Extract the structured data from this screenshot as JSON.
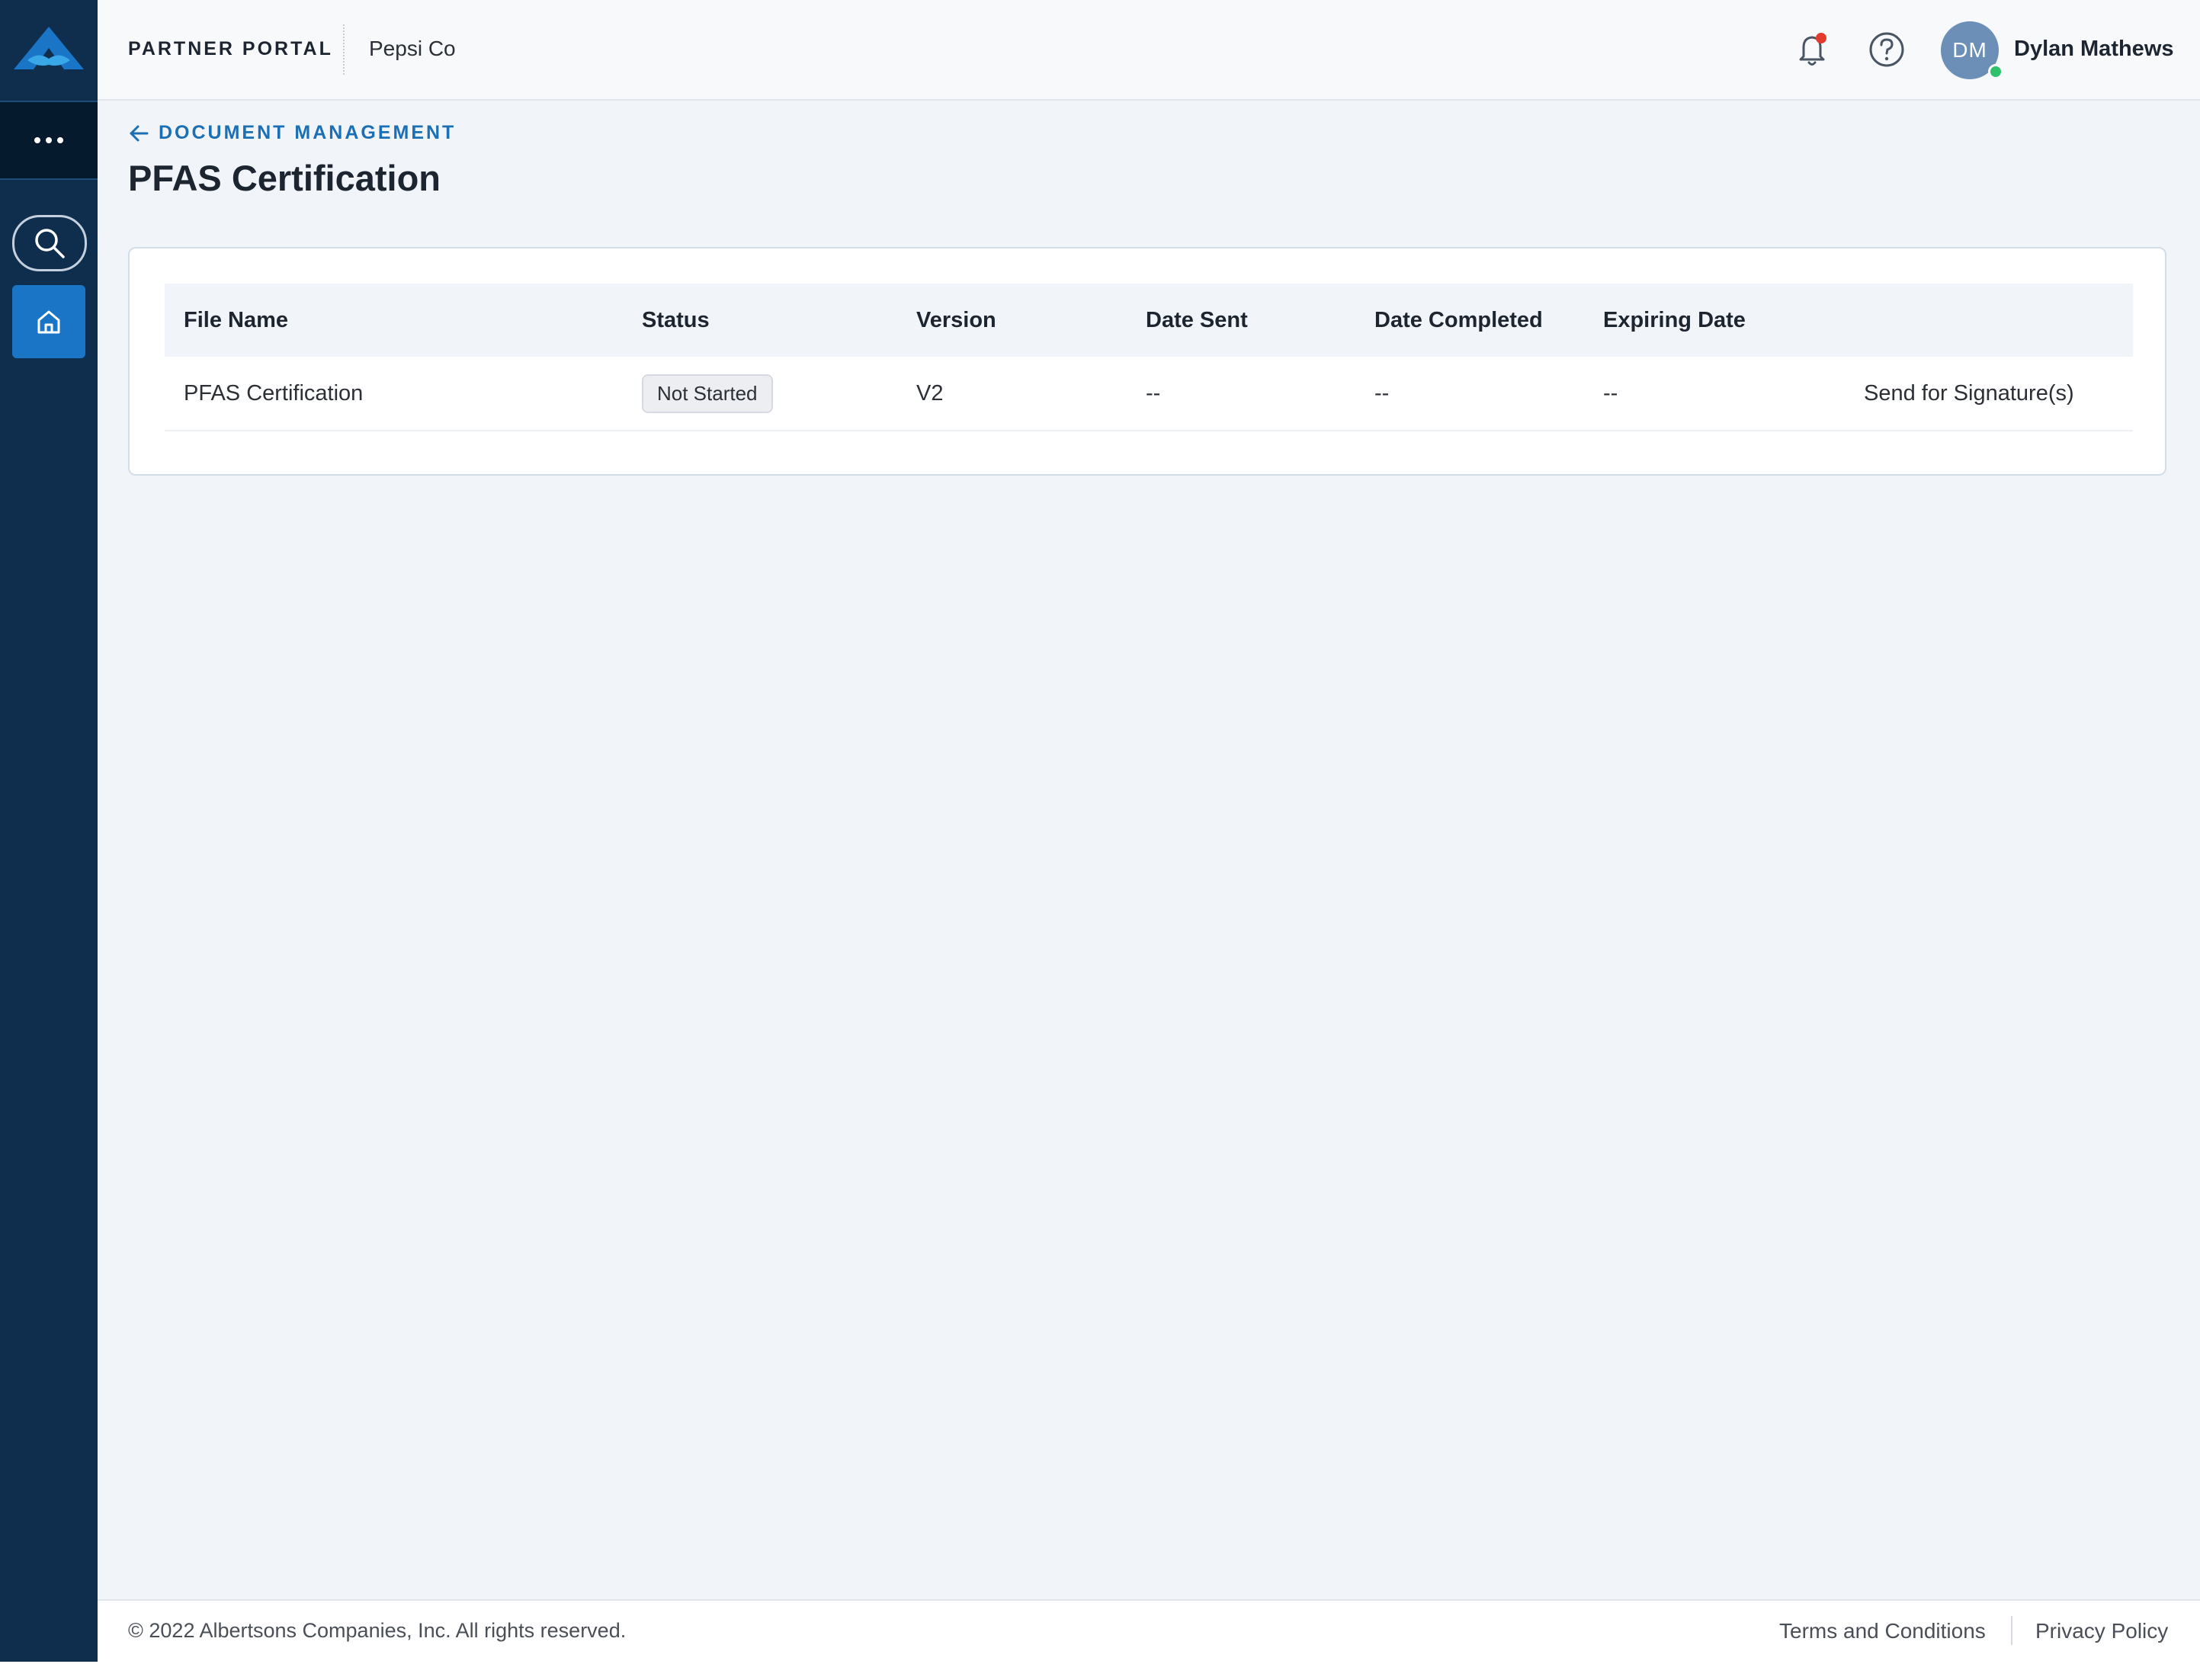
{
  "header": {
    "portal_title": "PARTNER PORTAL",
    "company": "Pepsi Co",
    "user": {
      "initials": "DM",
      "name": "Dylan Mathews"
    },
    "icons": [
      "bell-icon",
      "help-icon"
    ],
    "notification_dot_color": "#e53b2c"
  },
  "sidebar": {
    "items": [
      {
        "icon": "more-icon"
      },
      {
        "icon": "search-icon"
      },
      {
        "icon": "home-icon",
        "active": true
      }
    ]
  },
  "breadcrumb": {
    "label": "DOCUMENT MANAGEMENT"
  },
  "page": {
    "title": "PFAS Certification"
  },
  "table": {
    "columns": [
      "File Name",
      "Status",
      "Version",
      "Date Sent",
      "Date Completed",
      "Expiring Date"
    ],
    "rows": [
      {
        "file_name": "PFAS Certification",
        "status": "Not Started",
        "version": "V2",
        "date_sent": "--",
        "date_completed": "--",
        "expiring_date": "--",
        "action": "Send for Signature(s)"
      }
    ]
  },
  "footer": {
    "copyright": "© 2022 Albertsons Companies, Inc. All rights reserved.",
    "links": [
      "Terms and Conditions",
      "Privacy Policy"
    ]
  },
  "colors": {
    "sidebar_bg": "#0f2d4d",
    "accent": "#1b75c6",
    "link": "#1b6fb5",
    "page_bg": "#f1f4f8"
  }
}
